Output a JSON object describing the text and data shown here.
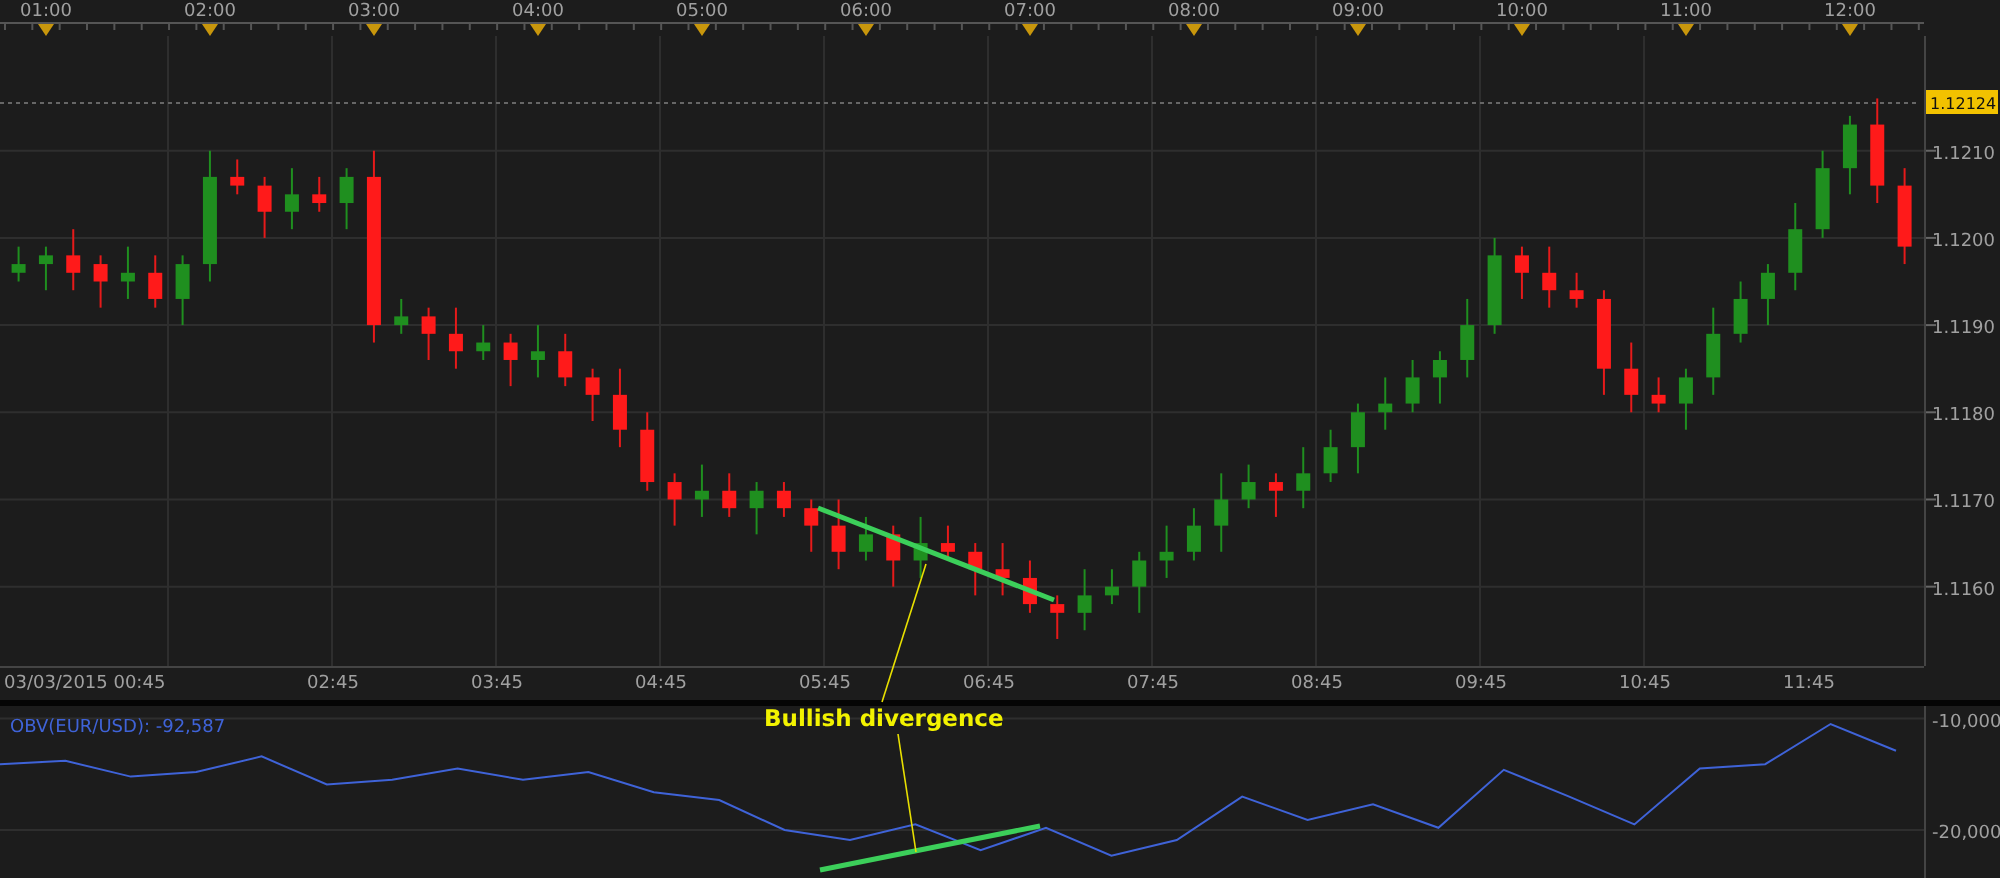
{
  "price_chart": {
    "top_time_labels": [
      "01:00",
      "02:00",
      "03:00",
      "04:00",
      "05:00",
      "06:00",
      "07:00",
      "08:00",
      "09:00",
      "10:00",
      "11:00",
      "12:00"
    ],
    "start_label": "03/03/2015 00:45",
    "last_price": "1.12124",
    "chart_data": {
      "type": "candlestick",
      "ylim": [
        1.11509,
        1.12227
      ],
      "xlim": [
        43.2,
        747.1
      ],
      "xticks": [
        {
          "value": 165,
          "label": "02:45"
        },
        {
          "value": 225,
          "label": "03:45"
        },
        {
          "value": 285,
          "label": "04:45"
        },
        {
          "value": 345,
          "label": "05:45"
        },
        {
          "value": 405,
          "label": "06:45"
        },
        {
          "value": 465,
          "label": "07:45"
        },
        {
          "value": 525,
          "label": "08:45"
        },
        {
          "value": 585,
          "label": "09:45"
        },
        {
          "value": 645,
          "label": "10:45"
        },
        {
          "value": 705,
          "label": "11:45"
        }
      ],
      "yticks": [
        {
          "value": 1.121,
          "label": "1.1210"
        },
        {
          "value": 1.12,
          "label": "1.1200"
        },
        {
          "value": 1.119,
          "label": "1.1190"
        },
        {
          "value": 1.118,
          "label": "1.1180"
        },
        {
          "value": 1.117,
          "label": "1.1170"
        },
        {
          "value": 1.116,
          "label": "1.1160"
        }
      ],
      "x": [
        50,
        60,
        70,
        80,
        90,
        100,
        110,
        120,
        130,
        140,
        150,
        160,
        170,
        180,
        190,
        200,
        210,
        220,
        230,
        240,
        250,
        260,
        270,
        280,
        290,
        300,
        310,
        320,
        330,
        340,
        350,
        360,
        370,
        380,
        390,
        400,
        410,
        420,
        430,
        440,
        450,
        460,
        470,
        480,
        490,
        500,
        510,
        520,
        530,
        540,
        550,
        560,
        570,
        580,
        590,
        600,
        610,
        620,
        630,
        640,
        650,
        660,
        670,
        680,
        690,
        700,
        710,
        720,
        730,
        740
      ],
      "ohlc": [
        [
          1.1196,
          1.1199,
          1.1195,
          1.1197
        ],
        [
          1.1197,
          1.1199,
          1.1194,
          1.1198
        ],
        [
          1.1198,
          1.1201,
          1.1194,
          1.1196
        ],
        [
          1.1197,
          1.1198,
          1.1192,
          1.1195
        ],
        [
          1.1195,
          1.1199,
          1.1193,
          1.1196
        ],
        [
          1.1196,
          1.1198,
          1.1192,
          1.1193
        ],
        [
          1.1193,
          1.1198,
          1.119,
          1.1197
        ],
        [
          1.1197,
          1.121,
          1.1195,
          1.1207
        ],
        [
          1.1207,
          1.1209,
          1.1205,
          1.1206
        ],
        [
          1.1206,
          1.1207,
          1.12,
          1.1203
        ],
        [
          1.1203,
          1.1208,
          1.1201,
          1.1205
        ],
        [
          1.1205,
          1.1207,
          1.1203,
          1.1204
        ],
        [
          1.1204,
          1.1208,
          1.1201,
          1.1207
        ],
        [
          1.1207,
          1.121,
          1.1188,
          1.119
        ],
        [
          1.119,
          1.1193,
          1.1189,
          1.1191
        ],
        [
          1.1191,
          1.1192,
          1.1186,
          1.1189
        ],
        [
          1.1189,
          1.1192,
          1.1185,
          1.1187
        ],
        [
          1.1187,
          1.119,
          1.1186,
          1.1188
        ],
        [
          1.1188,
          1.1189,
          1.1183,
          1.1186
        ],
        [
          1.1186,
          1.119,
          1.1184,
          1.1187
        ],
        [
          1.1187,
          1.1189,
          1.1183,
          1.1184
        ],
        [
          1.1184,
          1.1185,
          1.1179,
          1.1182
        ],
        [
          1.1182,
          1.1185,
          1.1176,
          1.1178
        ],
        [
          1.1178,
          1.118,
          1.1171,
          1.1172
        ],
        [
          1.1172,
          1.1173,
          1.1167,
          1.117
        ],
        [
          1.117,
          1.1174,
          1.1168,
          1.1171
        ],
        [
          1.1171,
          1.1173,
          1.1168,
          1.1169
        ],
        [
          1.1169,
          1.1172,
          1.1166,
          1.1171
        ],
        [
          1.1171,
          1.1172,
          1.1168,
          1.1169
        ],
        [
          1.1169,
          1.117,
          1.1164,
          1.1167
        ],
        [
          1.1167,
          1.117,
          1.1162,
          1.1164
        ],
        [
          1.1164,
          1.1168,
          1.1163,
          1.1166
        ],
        [
          1.1166,
          1.1167,
          1.116,
          1.1163
        ],
        [
          1.1163,
          1.1168,
          1.1161,
          1.1165
        ],
        [
          1.1165,
          1.1167,
          1.1163,
          1.1164
        ],
        [
          1.1164,
          1.1165,
          1.1159,
          1.1162
        ],
        [
          1.1162,
          1.1165,
          1.1159,
          1.1161
        ],
        [
          1.1161,
          1.1163,
          1.1157,
          1.1158
        ],
        [
          1.1158,
          1.1159,
          1.1154,
          1.1157
        ],
        [
          1.1157,
          1.1162,
          1.1155,
          1.1159
        ],
        [
          1.1159,
          1.1162,
          1.1158,
          1.116
        ],
        [
          1.116,
          1.1164,
          1.1157,
          1.1163
        ],
        [
          1.1163,
          1.1167,
          1.1161,
          1.1164
        ],
        [
          1.1164,
          1.1169,
          1.1163,
          1.1167
        ],
        [
          1.1167,
          1.1173,
          1.1164,
          1.117
        ],
        [
          1.117,
          1.1174,
          1.1169,
          1.1172
        ],
        [
          1.1172,
          1.1173,
          1.1168,
          1.1171
        ],
        [
          1.1171,
          1.1176,
          1.1169,
          1.1173
        ],
        [
          1.1173,
          1.1178,
          1.1172,
          1.1176
        ],
        [
          1.1176,
          1.1181,
          1.1173,
          1.118
        ],
        [
          1.118,
          1.1184,
          1.1178,
          1.1181
        ],
        [
          1.1181,
          1.1186,
          1.118,
          1.1184
        ],
        [
          1.1184,
          1.1187,
          1.1181,
          1.1186
        ],
        [
          1.1186,
          1.1193,
          1.1184,
          1.119
        ],
        [
          1.119,
          1.12,
          1.1189,
          1.1198
        ],
        [
          1.1198,
          1.1199,
          1.1193,
          1.1196
        ],
        [
          1.1196,
          1.1199,
          1.1192,
          1.1194
        ],
        [
          1.1194,
          1.1196,
          1.1192,
          1.1193
        ],
        [
          1.1193,
          1.1194,
          1.1182,
          1.1185
        ],
        [
          1.1185,
          1.1188,
          1.118,
          1.1182
        ],
        [
          1.1182,
          1.1184,
          1.118,
          1.1181
        ],
        [
          1.1181,
          1.1185,
          1.1178,
          1.1184
        ],
        [
          1.1184,
          1.1192,
          1.1182,
          1.1189
        ],
        [
          1.1189,
          1.1195,
          1.1188,
          1.1193
        ],
        [
          1.1193,
          1.1197,
          1.119,
          1.1196
        ],
        [
          1.1196,
          1.1204,
          1.1194,
          1.1201
        ],
        [
          1.1201,
          1.121,
          1.12,
          1.1208
        ],
        [
          1.1208,
          1.1214,
          1.1205,
          1.1213
        ],
        [
          1.1213,
          1.1216,
          1.1204,
          1.1206
        ],
        [
          1.1206,
          1.1208,
          1.1197,
          1.1199
        ]
      ]
    }
  },
  "annotation": {
    "text": "Bullish divergence"
  },
  "obv_panel": {
    "title": "OBV(EUR/USD): -92,587",
    "chart_data": {
      "type": "line",
      "ylim": [
        -24300,
        -8700
      ],
      "yticks": [
        {
          "value": -10000,
          "label": "-10,000"
        },
        {
          "value": -20000,
          "label": "-20,000"
        }
      ],
      "series": [
        {
          "color": "#3f63d8",
          "values": [
            -14100,
            -13800,
            -15200,
            -14800,
            -13400,
            -15900,
            -15500,
            -14500,
            -15500,
            -14800,
            -16600,
            -17300,
            -20000,
            -20900,
            -19500,
            -21800,
            -19800,
            -22300,
            -20900,
            -17000,
            -19100,
            -17700,
            -19800,
            -14600,
            -17000,
            -19500,
            -14500,
            -14100,
            -10500,
            -12900
          ]
        }
      ]
    }
  }
}
